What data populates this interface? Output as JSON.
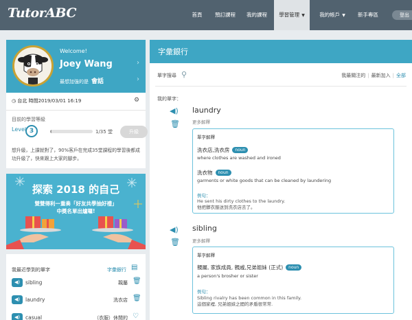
{
  "nav": {
    "logo": "TutorABC",
    "items": [
      {
        "label": "首頁"
      },
      {
        "label": "預訂課程"
      },
      {
        "label": "我的課程"
      },
      {
        "label": "學習管理"
      },
      {
        "label": "我的帳戶"
      },
      {
        "label": "新手專區"
      }
    ],
    "logout": "登出"
  },
  "profile": {
    "welcome": "Welcome!",
    "name": "Joey Wang",
    "strongest_prefix": "最想加強的是",
    "strongest_value": "會話",
    "time": "台北 時間2019/03/01 16:19",
    "level_heading": "目前的學習等級",
    "level_label": "Level",
    "level_value": "3",
    "progress_text": "1/35 堂",
    "progress_fraction": 0.03,
    "upgrade_label": "升級",
    "promo_text": "想升級，上課就對了，90%客戶在完成35堂課程的學習後都成功升級了，快來跟上大家的腳步。"
  },
  "banner": {
    "title": "探索 2018 的自己",
    "line1": "雙雙得利一重奏「好友共學抽好禮」",
    "line2": "中獎名單出爐囉!"
  },
  "recent": {
    "heading": "我最近學到的單字",
    "link": "字彙銀行",
    "items": [
      {
        "word": "sibling",
        "meaning": "親屬"
      },
      {
        "word": "laundry",
        "meaning": "洗衣店"
      },
      {
        "word": "casual",
        "meaning": "（衣服）休閒的"
      }
    ]
  },
  "main": {
    "title": "字彙銀行",
    "search_label": "單字搜尋",
    "filters": {
      "followed": "我最關注的",
      "latest": "最新加入",
      "all": "全部"
    },
    "my_words_label": "我的單字：",
    "entries": [
      {
        "word": "laundry",
        "more": "更多解釋",
        "def_title": "單字解釋",
        "defs": [
          {
            "zh": "洗衣店,洗衣房",
            "pos": "noun",
            "en": "where clothes are washed and ironed"
          },
          {
            "zh": "洗衣物",
            "pos": "noun",
            "en": "garments or white goods that can be cleaned by laundering"
          }
        ],
        "example_label": "例句：",
        "example_en": "He sent his dirty clothes to the laundry.",
        "example_zh": "他把髒衣服送到洗衣店去了。"
      },
      {
        "word": "sibling",
        "more": "更多解釋",
        "def_title": "單字解釋",
        "defs": [
          {
            "zh": "親屬, 家族成員, 親戚,兄弟姐妹 (正式)",
            "pos": "noun",
            "en": "a person's brosher or sister"
          }
        ],
        "example_label": "例句：",
        "example_en": "Sibling rivalry has been common in this family.",
        "example_zh": "這個家裡, 兄弟姐妹之間的矛盾很常常."
      }
    ]
  }
}
